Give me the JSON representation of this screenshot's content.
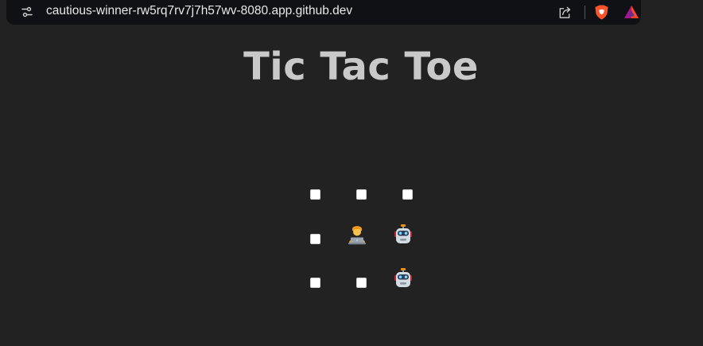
{
  "browser": {
    "url": "cautious-winner-rw5rq7rv7j7h57wv-8080.app.github.dev",
    "icons": [
      "site-info-icon",
      "share-icon",
      "brave-shields-icon",
      "brave-rewards-icon"
    ]
  },
  "page": {
    "title": "Tic Tac Toe"
  },
  "board": {
    "cells": [
      [
        "empty",
        "empty",
        "empty"
      ],
      [
        "empty",
        "player",
        "computer"
      ],
      [
        "empty",
        "empty",
        "computer"
      ]
    ],
    "symbols": {
      "player": "technologist-emoji",
      "computer": "robot-emoji"
    }
  },
  "colors": {
    "background": "#222222",
    "title": "#c9c9c9",
    "address_bar": "#101114"
  }
}
